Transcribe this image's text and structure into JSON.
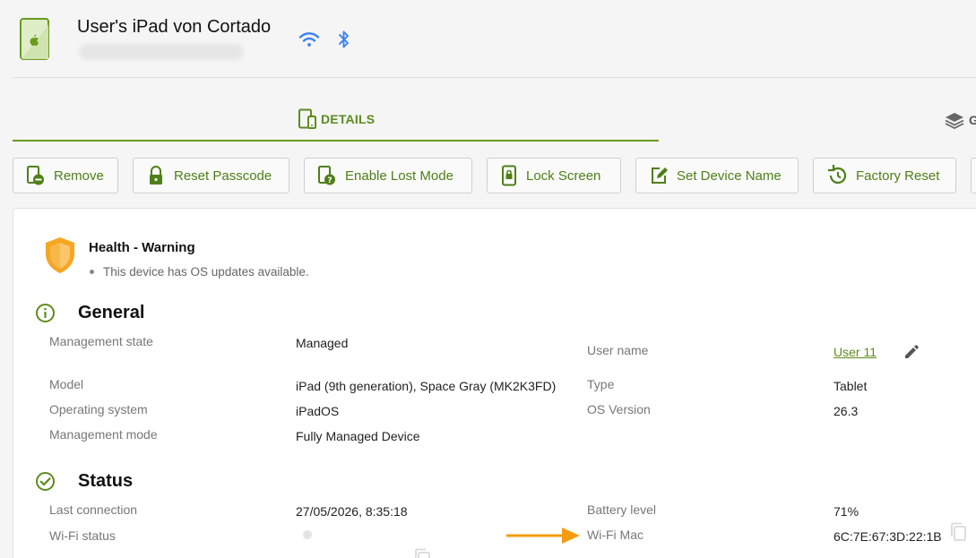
{
  "header": {
    "title": "User's iPad von Cortado",
    "icons": [
      "ipad-apple-icon",
      "wifi-icon",
      "bluetooth-icon"
    ]
  },
  "tabs": {
    "details": "DETAILS",
    "next_partial": "G"
  },
  "actions": [
    {
      "label": "Remove",
      "icon": "remove-device-icon"
    },
    {
      "label": "Reset Passcode",
      "icon": "lock-icon"
    },
    {
      "label": "Enable Lost Mode",
      "icon": "lost-mode-icon"
    },
    {
      "label": "Lock Screen",
      "icon": "lock-screen-icon"
    },
    {
      "label": "Set Device Name",
      "icon": "edit-icon"
    },
    {
      "label": "Factory Reset",
      "icon": "history-icon"
    }
  ],
  "health": {
    "title": "Health - Warning",
    "message": "This device has OS updates available."
  },
  "general": {
    "title": "General",
    "management_state": {
      "label": "Management state",
      "value": "Managed"
    },
    "user_name": {
      "label": "User name",
      "value": "User 11"
    },
    "model": {
      "label": "Model",
      "value": "iPad (9th generation), Space Gray (MK2K3FD)"
    },
    "type": {
      "label": "Type",
      "value": "Tablet"
    },
    "os": {
      "label": "Operating system",
      "value": "iPadOS"
    },
    "os_version": {
      "label": "OS Version",
      "value": "26.3"
    },
    "mgmt_mode": {
      "label": "Management mode",
      "value": "Fully Managed Device"
    }
  },
  "status": {
    "title": "Status",
    "last_connection": {
      "label": "Last connection",
      "value": "27/05/2026, 8:35:18"
    },
    "battery": {
      "label": "Battery level",
      "value": "71%"
    },
    "wifi_status": {
      "label": "Wi-Fi status"
    },
    "wifi_mac": {
      "label": "Wi-Fi Mac",
      "value": "6C:7E:67:3D:22:1B"
    }
  },
  "colors": {
    "accent": "#5c8c1e",
    "warning": "#f5a623",
    "bluetooth": "#3b82f6"
  }
}
